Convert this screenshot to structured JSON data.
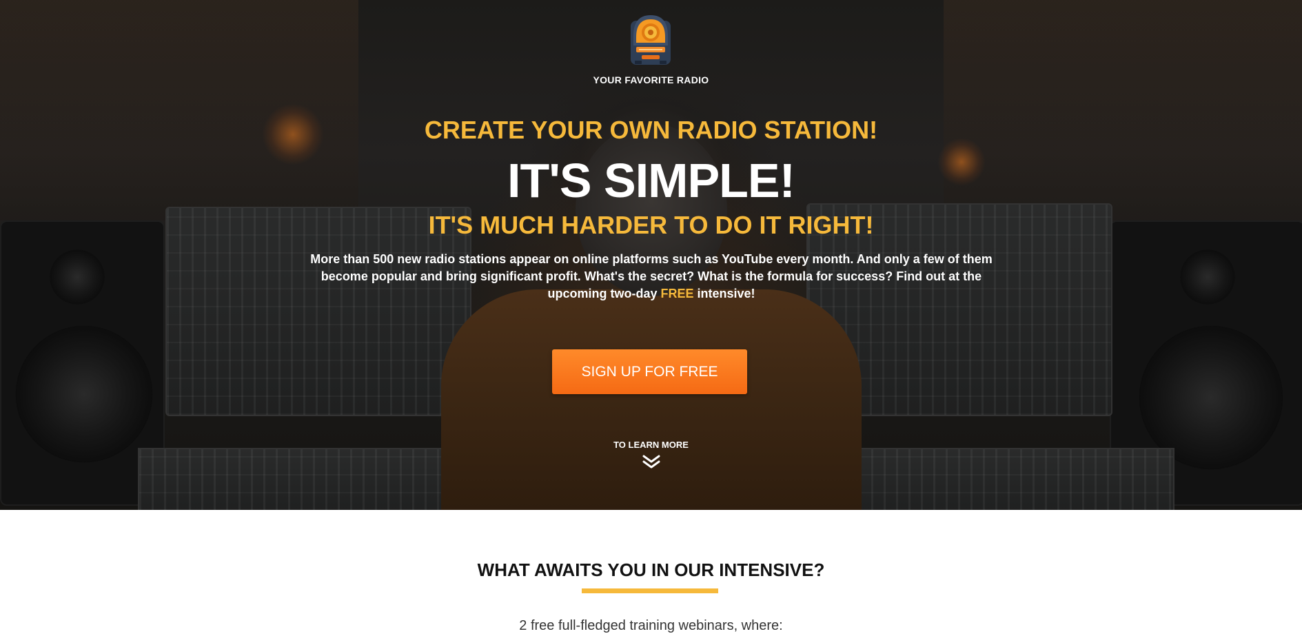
{
  "brand": {
    "name": "YOUR FAVORITE RADIO",
    "logo_icon": "retro-radio-icon"
  },
  "hero": {
    "kicker": "CREATE YOUR OWN RADIO STATION!",
    "headline": "IT'S SIMPLE!",
    "subhead": "IT'S MUCH HARDER TO DO IT RIGHT!",
    "description_before": "More than 500 new radio stations appear on online platforms such as YouTube every month. And only a few of them become popular and bring significant profit. What's the secret? What is the formula for success? Find out at the upcoming two-day ",
    "description_accent": "FREE",
    "description_after": " intensive!",
    "cta_label": "SIGN UP FOR FREE",
    "learn_more_label": "TO LEARN MORE",
    "learn_more_icon": "double-chevron-down-icon"
  },
  "section": {
    "title": "WHAT AWAITS YOU IN OUR INTENSIVE?",
    "text": "2 free full-fledged training webinars, where:"
  },
  "colors": {
    "accent_yellow": "#f6b93b",
    "cta_orange": "#f56a14",
    "text_white": "#ffffff",
    "title_dark": "#111111"
  }
}
